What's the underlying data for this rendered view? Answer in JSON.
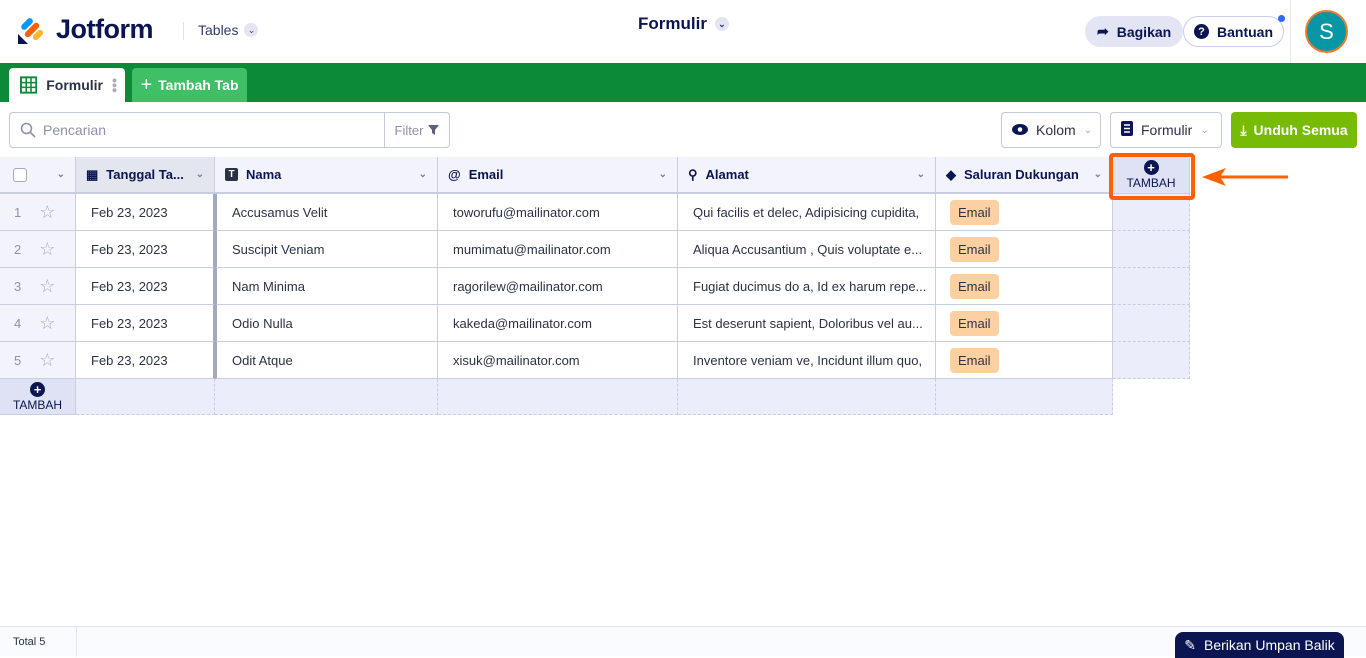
{
  "header": {
    "brand": "Jotform",
    "product": "Tables",
    "title": "Formulir",
    "share": "Bagikan",
    "help": "Bantuan",
    "avatar": "S"
  },
  "tabs": {
    "active": "Formulir",
    "add": "Tambah Tab"
  },
  "toolbar": {
    "search_placeholder": "Pencarian",
    "filter": "Filter",
    "columns": "Kolom",
    "form": "Formulir",
    "download": "Unduh Semua"
  },
  "table": {
    "columns": [
      {
        "label": "Tanggal Ta...",
        "icon": "calendar-icon"
      },
      {
        "label": "Nama",
        "icon": "text-icon"
      },
      {
        "label": "Email",
        "icon": "at-icon"
      },
      {
        "label": "Alamat",
        "icon": "location-icon"
      },
      {
        "label": "Saluran Dukungan",
        "icon": "tag-icon"
      }
    ],
    "add_label": "TAMBAH",
    "rows": [
      {
        "n": "1",
        "date": "Feb 23, 2023",
        "name": "Accusamus Velit",
        "email": "toworufu@mailinator.com",
        "address": "Qui facilis et delec, Adipisicing cupidita,",
        "channel": "Email"
      },
      {
        "n": "2",
        "date": "Feb 23, 2023",
        "name": "Suscipit Veniam",
        "email": "mumimatu@mailinator.com",
        "address": "Aliqua Accusantium , Quis voluptate e...",
        "channel": "Email"
      },
      {
        "n": "3",
        "date": "Feb 23, 2023",
        "name": "Nam Minima",
        "email": "ragorilew@mailinator.com",
        "address": "Fugiat ducimus do a, Id ex harum repe...",
        "channel": "Email"
      },
      {
        "n": "4",
        "date": "Feb 23, 2023",
        "name": "Odio Nulla",
        "email": "kakeda@mailinator.com",
        "address": "Est deserunt sapient, Doloribus vel au...",
        "channel": "Email"
      },
      {
        "n": "5",
        "date": "Feb 23, 2023",
        "name": "Odit Atque",
        "email": "xisuk@mailinator.com",
        "address": "Inventore veniam ve, Incidunt illum quo,",
        "channel": "Email"
      }
    ]
  },
  "footer": {
    "total": "Total 5",
    "feedback": "Berikan Umpan Balik"
  },
  "colors": {
    "green": "#0c8a37",
    "accent": "#ff6100",
    "download": "#78bb07",
    "navy": "#0a1551"
  }
}
